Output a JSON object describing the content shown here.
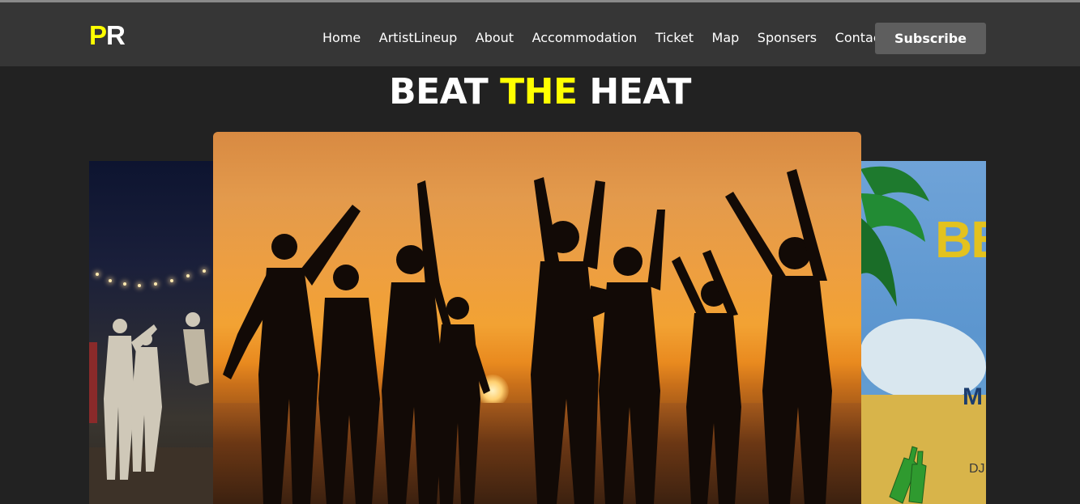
{
  "logo": {
    "first": "P",
    "rest": "R"
  },
  "nav": {
    "items": [
      "Home",
      "ArtistLineup",
      "About",
      "Accommodation",
      "Ticket",
      "Map",
      "Sponsers",
      "Contact"
    ],
    "subscribe_label": "Subscribe"
  },
  "headline": {
    "part1": "BEAT",
    "part2": "THE",
    "part3": "HEAT"
  },
  "colors": {
    "accent": "#ffff00",
    "navbar": "#363636",
    "background": "#222222",
    "button": "#5e5e5e"
  },
  "carousel": {
    "right_poster": {
      "big_text": "BE",
      "sub_text": "M",
      "dj_text": "DJ"
    }
  }
}
